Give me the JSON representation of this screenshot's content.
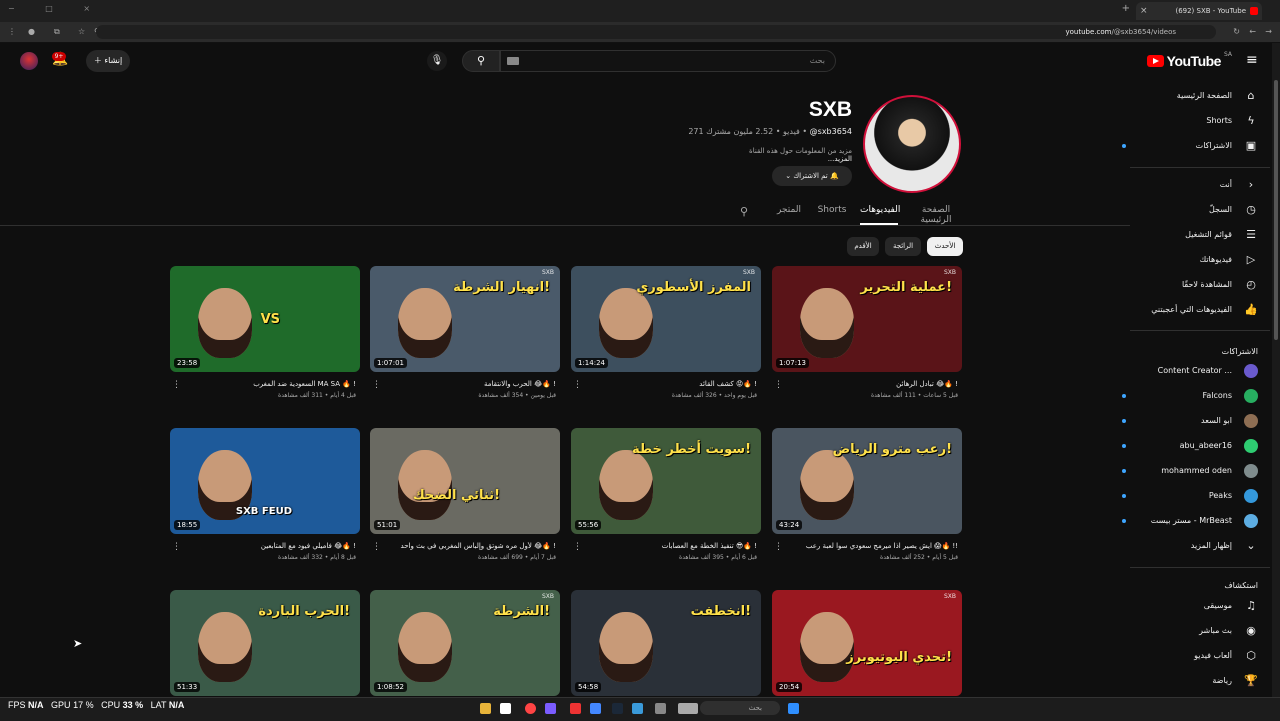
{
  "browser": {
    "tab_title": "(692) SXB - YouTube",
    "url_host": "youtube.com",
    "url_path": "/@sxb3654/videos"
  },
  "header": {
    "logo_text": "YouTube",
    "region": "SA",
    "search_placeholder": "بحث",
    "create_label": "إنشاء",
    "notifications_count": "9+"
  },
  "sidebar": {
    "main": [
      {
        "label": "الصفحة الرئيسية",
        "icon": "home-icon"
      },
      {
        "label": "Shorts",
        "icon": "shorts-icon"
      },
      {
        "label": "الاشتراكات",
        "icon": "subscriptions-icon"
      }
    ],
    "you_heading": "أنت",
    "you": [
      {
        "label": "السجلّ",
        "icon": "history-icon"
      },
      {
        "label": "قوائم التشغيل",
        "icon": "playlist-icon"
      },
      {
        "label": "فيديوهاتك",
        "icon": "your-videos-icon"
      },
      {
        "label": "المشاهدة لاحقًا",
        "icon": "watch-later-icon"
      },
      {
        "label": "الفيديوهات التي أعجبتني",
        "icon": "like-icon"
      }
    ],
    "subs_heading": "الاشتراكات",
    "subs": [
      {
        "label": "Content Creator ...",
        "color": "#6a5acd"
      },
      {
        "label": "Falcons",
        "color": "#27ae60"
      },
      {
        "label": "ابو السعد",
        "color": "#8e6e53"
      },
      {
        "label": "abu_abeer16",
        "color": "#2ecc71"
      },
      {
        "label": "mohammed oden",
        "color": "#7f8c8d"
      },
      {
        "label": "Peaks",
        "color": "#3498db"
      },
      {
        "label": "مستر بيست - MrBeast",
        "color": "#5dade2"
      }
    ],
    "show_more": "إظهار المزيد",
    "explore_heading": "استكشاف",
    "explore": [
      {
        "label": "موسيقى",
        "icon": "music-icon"
      },
      {
        "label": "بث مباشر",
        "icon": "live-icon"
      },
      {
        "label": "ألعاب فيديو",
        "icon": "gaming-icon"
      },
      {
        "label": "رياضة",
        "icon": "trophy-icon"
      }
    ]
  },
  "channel": {
    "name": "SXB",
    "handle": "@sxb3654",
    "subscribers": "2.52 مليون مشترك",
    "video_count": "271 فيديو",
    "description": "مزيد من المعلومات حول هذه القناة",
    "more": "...المزيد",
    "subscribed_label": "تم الاشتراك"
  },
  "tabs": [
    {
      "label": "الصفحة الرئيسية",
      "active": false
    },
    {
      "label": "الفيديوهات",
      "active": true
    },
    {
      "label": "Shorts",
      "active": false
    },
    {
      "label": "المتجر",
      "active": false
    }
  ],
  "chips": [
    {
      "label": "الأحدث",
      "active": true
    },
    {
      "label": "الرائجة",
      "active": false
    },
    {
      "label": "الأقدم",
      "active": false
    }
  ],
  "videos": [
    {
      "title": "تبادل الرهائن 😂🔥 !",
      "views": "111 ألف مشاهدة",
      "age": "قبل 5 ساعات",
      "duration": "1:07:13",
      "art": "عملية التحرير!",
      "bg": "#5a1418"
    },
    {
      "title": "كشف القائد 😡🔥 !",
      "views": "326 ألف مشاهدة",
      "age": "قبل يوم واحد",
      "duration": "1:14:24",
      "art": "المفرز الأسطوري",
      "bg": "#3d4f5e"
    },
    {
      "title": "الحرب والانتقامة 😂🔥 !",
      "views": "354 ألف مشاهدة",
      "age": "قبل يومين",
      "duration": "1:07:01",
      "art": "انهيار الشرطة!",
      "bg": "#4a5a6a"
    },
    {
      "title": "السعودية ضد المغرب MA SA 🔥 !",
      "views": "311 ألف مشاهدة",
      "age": "قبل 4 أيام",
      "duration": "23:58",
      "art": "VS",
      "bg": "#1f6b2a"
    },
    {
      "title": "ايش يصير اذا ميرمج سعودي سوا لعبة رعب 😱🔥 !!",
      "views": "252 ألف مشاهدة",
      "age": "قبل 5 أيام",
      "duration": "43:24",
      "art": "رعب مترو الرياض!",
      "bg": "#4a5560"
    },
    {
      "title": "تنفيذ الخطة مع العصابات 😎🔥 !",
      "views": "395 ألف مشاهدة",
      "age": "قبل 6 أيام",
      "duration": "55:56",
      "art": "سويت أخطر خطة!",
      "bg": "#3f5a3a"
    },
    {
      "title": "لأول مره شوتق وإلباس المغربي في بث واحد 😂🔥 !",
      "views": "699 ألف مشاهدة",
      "age": "قبل 7 أيام",
      "duration": "51:01",
      "art": "ثنائي الضحك!",
      "bg": "#6a6a62"
    },
    {
      "title": "فاميلي فيود مع المتابعين 😂🔥 !",
      "views": "332 ألف مشاهدة",
      "age": "قبل 8 أيام",
      "duration": "18:55",
      "art": "SXB FEUD",
      "bg": "#1e5a9a"
    },
    {
      "title": "",
      "views": "",
      "age": "",
      "duration": "20:54",
      "art": "تحدي اليوتيوبرز!",
      "bg": "#9a1820"
    },
    {
      "title": "",
      "views": "",
      "age": "",
      "duration": "54:58",
      "art": "انخطفت!",
      "bg": "#2a3038"
    },
    {
      "title": "",
      "views": "",
      "age": "",
      "duration": "1:08:52",
      "art": "الشرطة!",
      "bg": "#44604a"
    },
    {
      "title": "",
      "views": "",
      "age": "",
      "duration": "51:33",
      "art": "الحرب الباردة!",
      "bg": "#3a5a48"
    }
  ],
  "taskbar": {
    "fps_label": "FPS",
    "fps_value": "N/A",
    "gpu_label": "GPU",
    "gpu_value": "17 %",
    "cpu_label": "CPU",
    "cpu_value": "33 %",
    "lat_label": "LAT",
    "lat_value": "N/A",
    "search_placeholder": "بحث"
  }
}
